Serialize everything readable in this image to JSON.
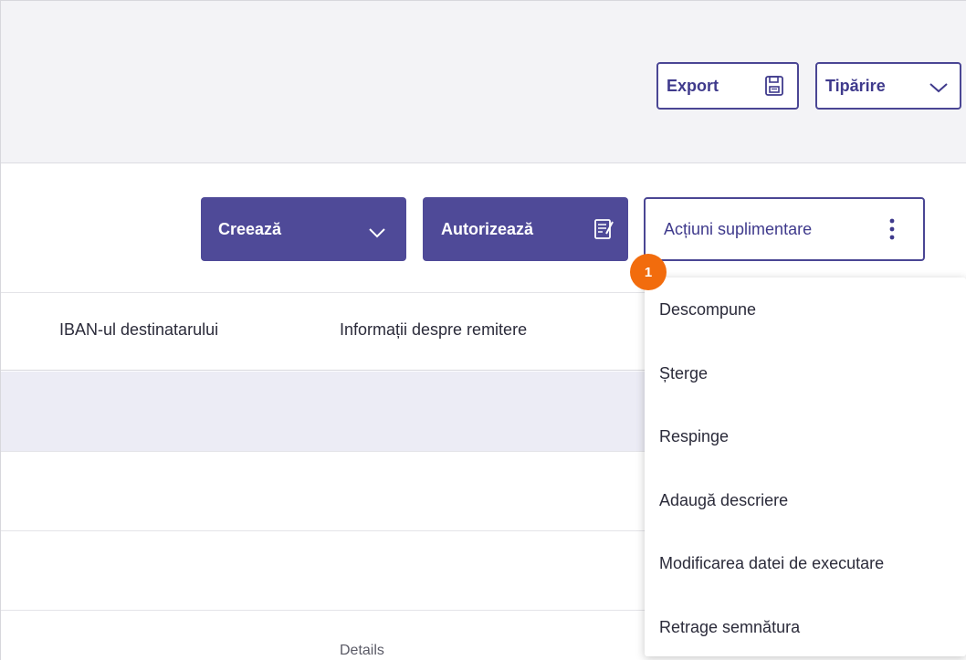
{
  "header": {
    "export_label": "Export",
    "export_icon": "save-icon",
    "print_label": "Tipărire",
    "print_icon": "chevron-down-icon"
  },
  "toolbar": {
    "create_label": "Creează",
    "create_icon": "chevron-down-icon",
    "authorize_label": "Autorizează",
    "authorize_icon": "sign-document-icon",
    "more_label": "Acțiuni suplimentare",
    "more_icon": "kebab-icon"
  },
  "badge": "1",
  "table": {
    "columns": [
      "IBAN-ul destinatarului",
      "Informații despre remitere"
    ],
    "details_link": "Details"
  },
  "menu": {
    "items": [
      "Descompune",
      "Șterge",
      "Respinge",
      "Adaugă descriere",
      "Modificarea datei de executare",
      "Retrage semnătura"
    ]
  },
  "colors": {
    "brand": "#4f4a98",
    "badge": "#f26c0d",
    "selected_row": "#ececf5"
  }
}
